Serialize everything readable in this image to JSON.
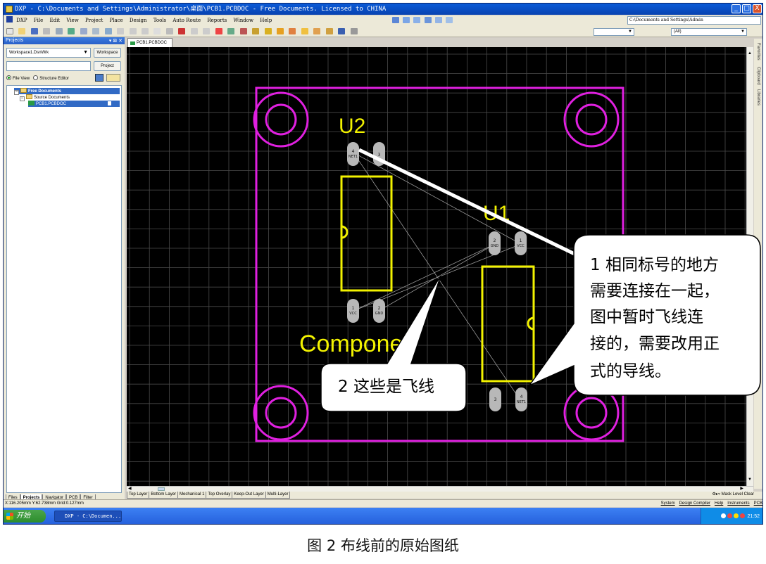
{
  "window": {
    "title": "DXP - C:\\Documents and Settings\\Administrator\\桌面\\PCB1.PCBDOC - Free Documents. Licensed to CHINA",
    "buttons": {
      "minimize": "_",
      "maximize": "□",
      "close": "X"
    }
  },
  "menu": {
    "items": [
      "DXP",
      "File",
      "Edit",
      "View",
      "Project",
      "Place",
      "Design",
      "Tools",
      "Auto Route",
      "Reports",
      "Window",
      "Help"
    ],
    "path": "C:\\Documents and Settings\\Admin"
  },
  "toolbar": {
    "filter_combo_1": "",
    "filter_combo_2": "(All)"
  },
  "panel": {
    "title": "Projects",
    "workspace_combo": "Workspace1.DsnWrk",
    "workspace_button": "Workspace",
    "project_button": "Project",
    "view_file": "File View",
    "view_structure": "Structure Editor",
    "tree": {
      "root": "Free Documents",
      "folder": "Source Documents",
      "file": "PCB1.PCBDOC"
    },
    "tabs": [
      "Files",
      "Projects",
      "Navigator",
      "PCB",
      "Filter"
    ]
  },
  "document": {
    "tab_label": "PCB1.PCBDOC"
  },
  "side_tabs": [
    "Favorites",
    "Clipboard",
    "Libraries"
  ],
  "pcb": {
    "u2_label": "U2",
    "u1_label": "U1",
    "component_text": "Componer",
    "u2_pads": [
      {
        "num": "4",
        "net": "NET1"
      },
      {
        "num": "3",
        "net": ""
      },
      {
        "num": "1",
        "net": "VCC"
      },
      {
        "num": "2",
        "net": "GND"
      }
    ],
    "u1_pads": [
      {
        "num": "2",
        "net": "GND"
      },
      {
        "num": "1",
        "net": "VCC"
      },
      {
        "num": "3",
        "net": ""
      },
      {
        "num": "4",
        "net": "NET1"
      }
    ],
    "colors": {
      "background": "#000000",
      "grid": "#4a4a4a",
      "board_outline": "#e020e0",
      "overlay": "#f2f200",
      "pad": "#b8b8b8",
      "ratsnest": "#9a9a9a"
    }
  },
  "layers": [
    "Top Layer",
    "Bottom Layer",
    "Mechanical 1",
    "Top Overlay",
    "Keep-Out Layer",
    "Multi-Layer"
  ],
  "layer_right": {
    "mask": "Mask Level",
    "clear": "Clear"
  },
  "status": {
    "coords": "X:116.205mm Y:62.738mm   Grid:0.127mm",
    "right": [
      "System",
      "Design Compiler",
      "Help",
      "Instruments",
      "PCB"
    ]
  },
  "taskbar": {
    "start": "开始",
    "task_item": "DXP - C:\\Documen...",
    "clock": "21:52"
  },
  "callouts": {
    "one_lines": [
      "1 相同标号的地方",
      "需要连接在一起，",
      "图中暂时飞线连",
      "接的，需要改用正",
      "式的导线。"
    ],
    "two": "2 这些是飞线"
  },
  "caption": "图 2 布线前的原始图纸"
}
